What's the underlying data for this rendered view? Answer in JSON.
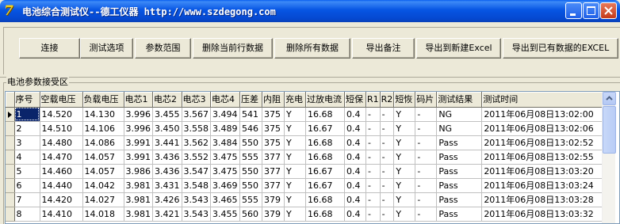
{
  "window": {
    "title": "电池综合测试仪--德工仪器 http://www.szdegong.com",
    "icon_glyph": "7",
    "controls": [
      "minimize",
      "maximize",
      "close"
    ]
  },
  "toolbar": {
    "buttons": [
      "连接",
      "测试选项",
      "参数范围",
      "删除当前行数据",
      "删除所有数据",
      "导出备注",
      "导出到新建Excel",
      "导出到已有数据的EXCEL"
    ]
  },
  "group": {
    "label": "电池参数接受区"
  },
  "grid": {
    "columns": [
      "序号",
      "空载电压",
      "负载电压",
      "电芯1",
      "电芯2",
      "电芯3",
      "电芯4",
      "压差",
      "内阻",
      "充电",
      "过放电流",
      "短保",
      "R1",
      "R2",
      "短恢",
      "码片",
      "测试结果",
      "测试时间"
    ],
    "rows": [
      [
        "1",
        "14.520",
        "14.130",
        "3.996",
        "3.455",
        "3.567",
        "3.494",
        "541",
        "375",
        "Y",
        "16.68",
        "0.4",
        "-",
        "-",
        "Y",
        "-",
        "NG",
        "2011年06月08日13:02:00"
      ],
      [
        "2",
        "14.510",
        "14.106",
        "3.996",
        "3.450",
        "3.558",
        "3.489",
        "546",
        "375",
        "Y",
        "16.67",
        "0.4",
        "-",
        "-",
        "Y",
        "-",
        "NG",
        "2011年06月08日13:02:06"
      ],
      [
        "3",
        "14.480",
        "14.086",
        "3.991",
        "3.441",
        "3.562",
        "3.484",
        "550",
        "375",
        "Y",
        "16.68",
        "0.4",
        "-",
        "-",
        "Y",
        "-",
        "Pass",
        "2011年06月08日13:02:52"
      ],
      [
        "4",
        "14.470",
        "14.057",
        "3.991",
        "3.436",
        "3.552",
        "3.475",
        "555",
        "377",
        "Y",
        "16.68",
        "0.4",
        "-",
        "-",
        "Y",
        "-",
        "Pass",
        "2011年06月08日13:02:55"
      ],
      [
        "5",
        "14.460",
        "14.057",
        "3.986",
        "3.436",
        "3.547",
        "3.475",
        "550",
        "377",
        "Y",
        "16.67",
        "0.4",
        "-",
        "-",
        "Y",
        "-",
        "Pass",
        "2011年06月08日13:03:20"
      ],
      [
        "6",
        "14.440",
        "14.042",
        "3.981",
        "3.431",
        "3.548",
        "3.469",
        "550",
        "377",
        "Y",
        "16.67",
        "0.4",
        "-",
        "-",
        "Y",
        "-",
        "Pass",
        "2011年06月08日13:03:24"
      ],
      [
        "7",
        "14.420",
        "14.027",
        "3.981",
        "3.426",
        "3.543",
        "3.465",
        "555",
        "379",
        "Y",
        "16.68",
        "0.4",
        "-",
        "-",
        "Y",
        "-",
        "Pass",
        "2011年06月08日13:03:28"
      ],
      [
        "8",
        "14.410",
        "14.018",
        "3.981",
        "3.421",
        "3.543",
        "3.455",
        "560",
        "379",
        "Y",
        "16.68",
        "0.4",
        "-",
        "-",
        "Y",
        "-",
        "Pass",
        "2011年06月08日13:03:32"
      ]
    ],
    "selected_row": 0
  }
}
